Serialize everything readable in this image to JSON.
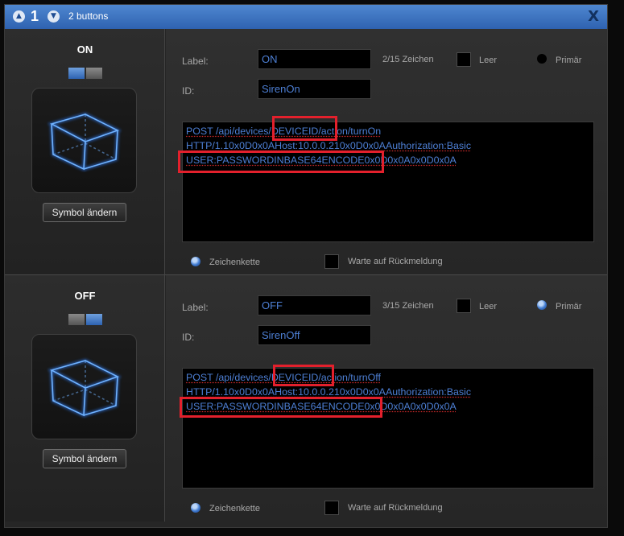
{
  "titlebar": {
    "number": "1",
    "title": "2 buttons",
    "close_label": "X",
    "up_icon": "chevron-up-icon",
    "down_icon": "chevron-down-icon"
  },
  "colors": {
    "accent": "#3f7ad0",
    "text_value": "#4d7fd4",
    "highlight": "#e3202c",
    "titlebar": "#3b73c2"
  },
  "buttons": [
    {
      "name": "ON",
      "toggle_state": "left-on",
      "symbol_button": "Symbol ändern",
      "label_caption": "Label:",
      "label_value": "ON",
      "char_count": "2/15 Zeichen",
      "leer_label": "Leer",
      "primaer_label": "Primär",
      "primaer_selected": false,
      "id_caption": "ID:",
      "id_value": "SirenOn",
      "request_lines": [
        "POST /api/devices/DEVICEID/action/turnOn",
        "HTTP/1.10x0D0x0AHost:10.0.0.210x0D0x0AAuthorization:Basic",
        "USER:PASSWORDINBASE64ENCODE0x0D0x0A0x0D0x0A"
      ],
      "string_option": "Zeichenkette",
      "wait_option": "Warte auf Rückmeldung"
    },
    {
      "name": "OFF",
      "toggle_state": "right-on",
      "symbol_button": "Symbol ändern",
      "label_caption": "Label:",
      "label_value": "OFF",
      "char_count": "3/15 Zeichen",
      "leer_label": "Leer",
      "primaer_label": "Primär",
      "primaer_selected": true,
      "id_caption": "ID:",
      "id_value": "SirenOff",
      "request_lines": [
        "POST /api/devices/DEVICEID/action/turnOff",
        "HTTP/1.10x0D0x0AHost:10.0.0.210x0D0x0AAuthorization:Basic",
        "USER:PASSWORDINBASE64ENCODE0x0D0x0A0x0D0x0A"
      ],
      "string_option": "Zeichenkette",
      "wait_option": "Warte auf Rückmeldung"
    }
  ]
}
